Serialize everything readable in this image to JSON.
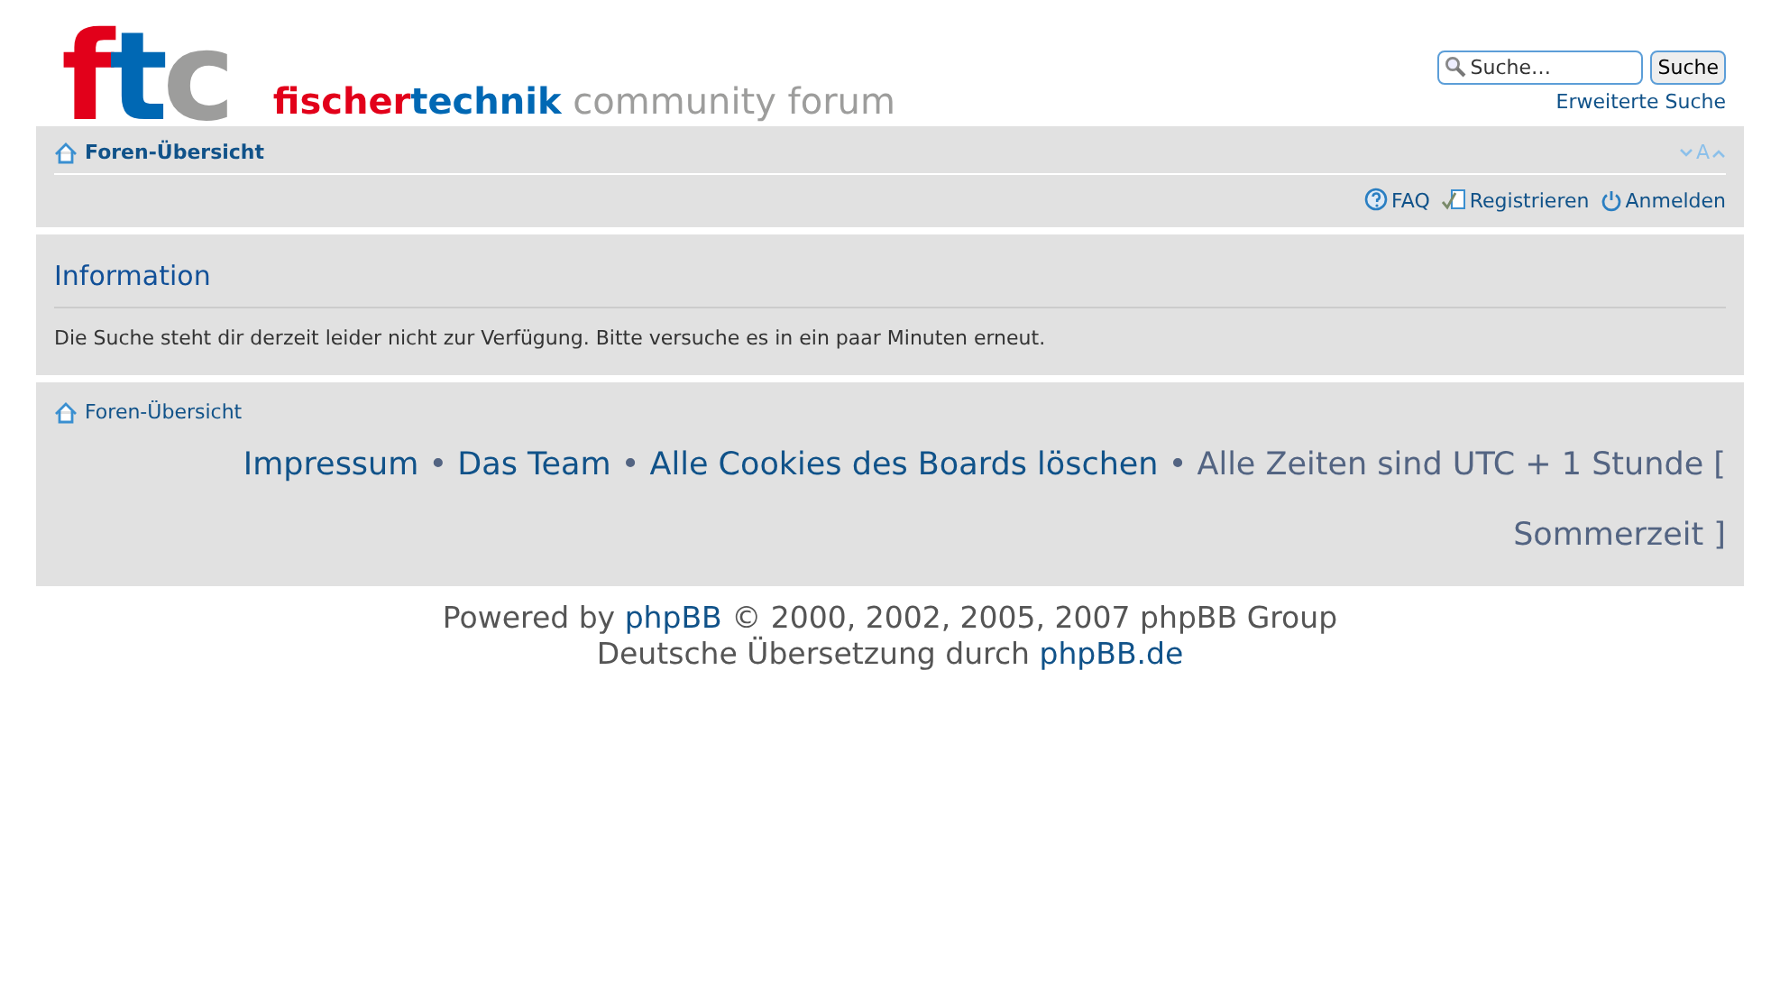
{
  "logo": {
    "letters": [
      {
        "text": "f",
        "color": "#e2001a"
      },
      {
        "text": "t",
        "color": "#0068b4"
      },
      {
        "text": "c",
        "color": "#9d9d9c"
      }
    ],
    "title_parts": [
      {
        "text": "fischer",
        "color": "#e2001a"
      },
      {
        "text": "technik",
        "color": "#0068b4"
      },
      {
        "text": " community forum",
        "color": "#9d9d9c"
      }
    ]
  },
  "search": {
    "placeholder": "Suche…",
    "button": "Suche",
    "advanced": "Erweiterte Suche"
  },
  "navbar": {
    "breadcrumb": "Foren-Übersicht",
    "font_size_toggle": "A",
    "links": [
      {
        "kind": "faq",
        "label": "FAQ"
      },
      {
        "kind": "register",
        "label": "Registrieren"
      },
      {
        "kind": "login",
        "label": "Anmelden"
      }
    ]
  },
  "panel": {
    "title": "Information",
    "message": "Die Suche steht dir derzeit leider nicht zur Verfügung. Bitte versuche es in ein paar Minuten erneut."
  },
  "footer": {
    "breadcrumb": "Foren-Übersicht",
    "items": [
      {
        "kind": "link",
        "text": "Impressum"
      },
      {
        "kind": "text",
        "text": " • "
      },
      {
        "kind": "link",
        "text": "Das Team"
      },
      {
        "kind": "text",
        "text": " • "
      },
      {
        "kind": "link",
        "text": "Alle Cookies des Boards löschen"
      },
      {
        "kind": "text",
        "text": " • Alle Zeiten sind UTC + 1 Stunde [ Sommerzeit ]"
      }
    ]
  },
  "copyright": [
    [
      {
        "kind": "text",
        "text": "Powered by "
      },
      {
        "kind": "link",
        "text": "phpBB"
      },
      {
        "kind": "text",
        "text": " © 2000, 2002, 2005, 2007 phpBB Group"
      }
    ],
    [
      {
        "kind": "text",
        "text": "Deutsche Übersetzung durch "
      },
      {
        "kind": "link",
        "text": "phpBB.de"
      }
    ]
  ]
}
